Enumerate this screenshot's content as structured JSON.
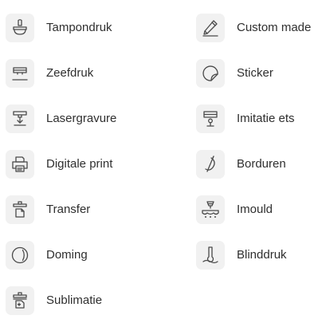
{
  "techniques_left": [
    {
      "label": "Tampondruk",
      "icon": "stamp-icon"
    },
    {
      "label": "Zeefdruk",
      "icon": "screen-print-icon"
    },
    {
      "label": "Lasergravure",
      "icon": "laser-icon"
    },
    {
      "label": "Digitale print",
      "icon": "printer-icon"
    },
    {
      "label": "Transfer",
      "icon": "transfer-icon"
    },
    {
      "label": "Doming",
      "icon": "doming-icon"
    },
    {
      "label": "Sublimatie",
      "icon": "sublimation-icon"
    }
  ],
  "techniques_right": [
    {
      "label": "Custom made",
      "icon": "pencil-icon"
    },
    {
      "label": "Sticker",
      "icon": "sticker-icon"
    },
    {
      "label": "Imitatie ets",
      "icon": "etching-icon"
    },
    {
      "label": "Borduren",
      "icon": "needle-icon"
    },
    {
      "label": "Imould",
      "icon": "mould-icon"
    },
    {
      "label": "Blinddruk",
      "icon": "blind-emboss-icon"
    }
  ],
  "colors": {
    "tile_background": "#f1f1f1",
    "icon_stroke": "#4a4a4a",
    "text": "#2f2f2f"
  }
}
